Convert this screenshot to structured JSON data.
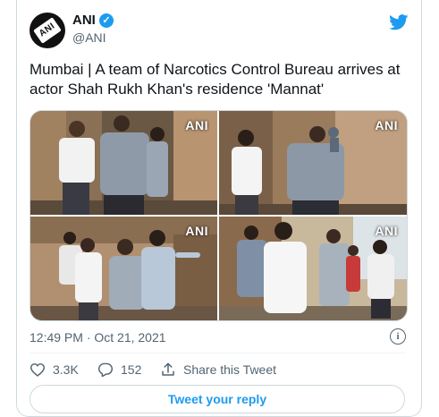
{
  "tweet": {
    "author_name": "ANI",
    "author_handle": "@ANI",
    "avatar_text": "ANI",
    "text": "Mumbai | A team of Narcotics Control Bureau arrives at actor Shah Rukh Khan's residence 'Mannat'",
    "timestamp": "12:49 PM · Oct 21, 2021",
    "photos": [
      {
        "watermark": "ANI"
      },
      {
        "watermark": "ANI"
      },
      {
        "watermark": "ANI"
      },
      {
        "watermark": "ANI"
      }
    ]
  },
  "actions": {
    "likes": "3.3K",
    "replies": "152",
    "share_label": "Share this Tweet",
    "reply_button": "Tweet your reply"
  },
  "colors": {
    "accent": "#1d9bf0",
    "muted": "#536471",
    "border": "#cfd9de"
  }
}
